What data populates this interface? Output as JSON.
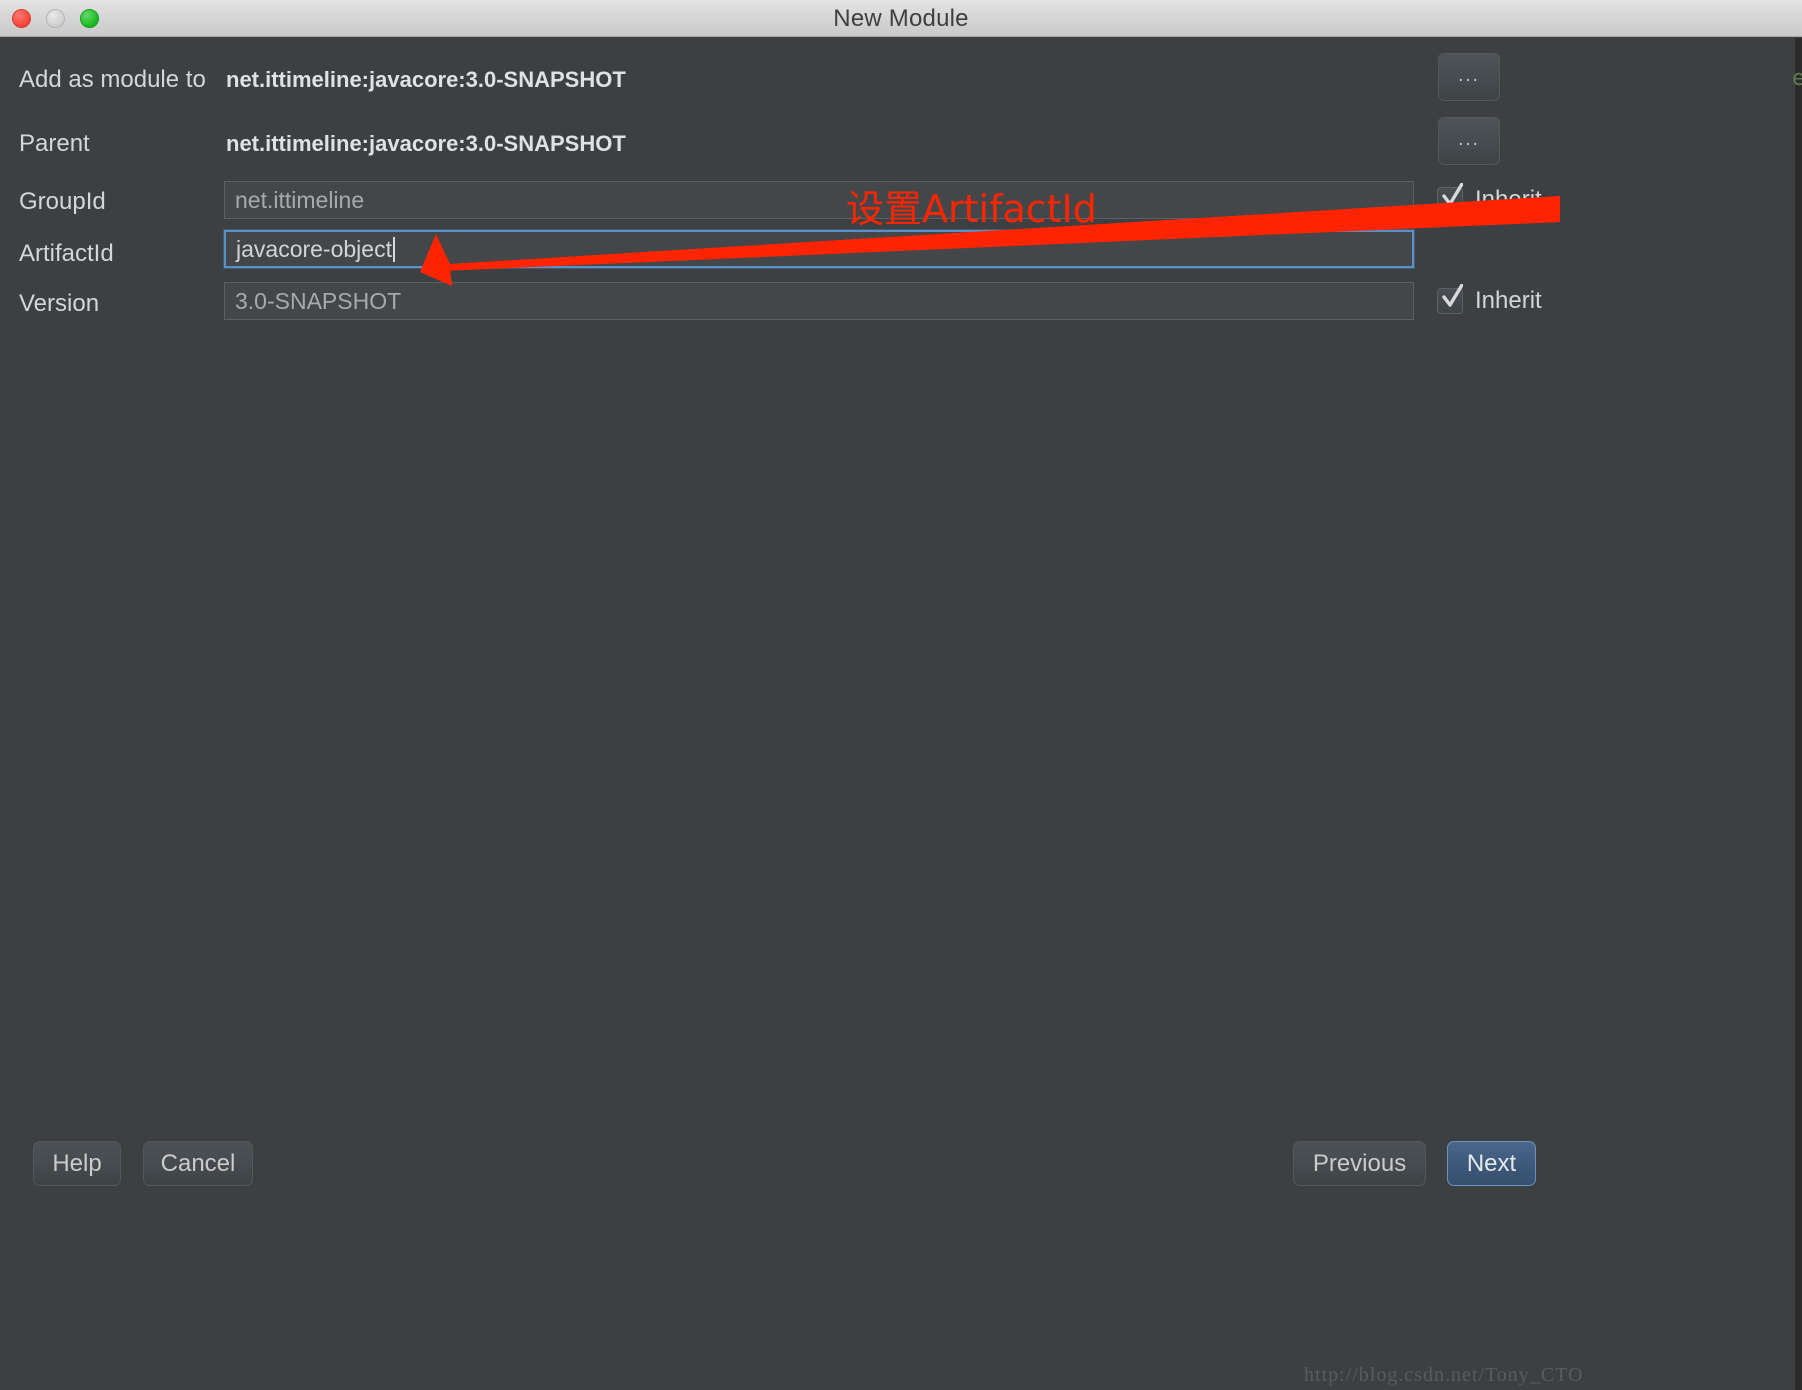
{
  "window": {
    "title": "New Module",
    "traffic_lights": [
      {
        "name": "close",
        "color": "#f44336"
      },
      {
        "name": "minimize",
        "color": "#cfcfcf"
      },
      {
        "name": "maximize",
        "color": "#18b81f"
      }
    ]
  },
  "form": {
    "rows": [
      {
        "label": "Add as module to",
        "kind": "static",
        "value": "net.ittimeline:javacore:3.0-SNAPSHOT",
        "browse_label": "...",
        "has_inherit": false
      },
      {
        "label": "Parent",
        "kind": "static",
        "value": "net.ittimeline:javacore:3.0-SNAPSHOT",
        "browse_label": "...",
        "has_inherit": false
      },
      {
        "label": "GroupId",
        "kind": "input",
        "value": "net.ittimeline",
        "placeholder": "net.ittimeline",
        "focused": false,
        "has_inherit": true,
        "inherit_label": "Inherit",
        "inherit_checked": true
      },
      {
        "label": "ArtifactId",
        "kind": "input",
        "value": "javacore-object",
        "placeholder": "",
        "focused": true,
        "has_inherit": false
      },
      {
        "label": "Version",
        "kind": "input",
        "value": "3.0-SNAPSHOT",
        "placeholder": "3.0-SNAPSHOT",
        "focused": false,
        "has_inherit": true,
        "inherit_label": "Inherit",
        "inherit_checked": true
      }
    ]
  },
  "annotation": {
    "text": "设置ArtifactId",
    "color": "#ff2400",
    "arrow_name": "red-arrow-pointing-to-artifactid-field"
  },
  "right_edge": {
    "glyph": "e",
    "color": "#5e7a4e"
  },
  "footer": {
    "help_label": "Help",
    "cancel_label": "Cancel",
    "previous_label": "Previous",
    "next_label": "Next"
  },
  "watermark": {
    "text": "http://blog.csdn.net/Tony_CTO"
  }
}
